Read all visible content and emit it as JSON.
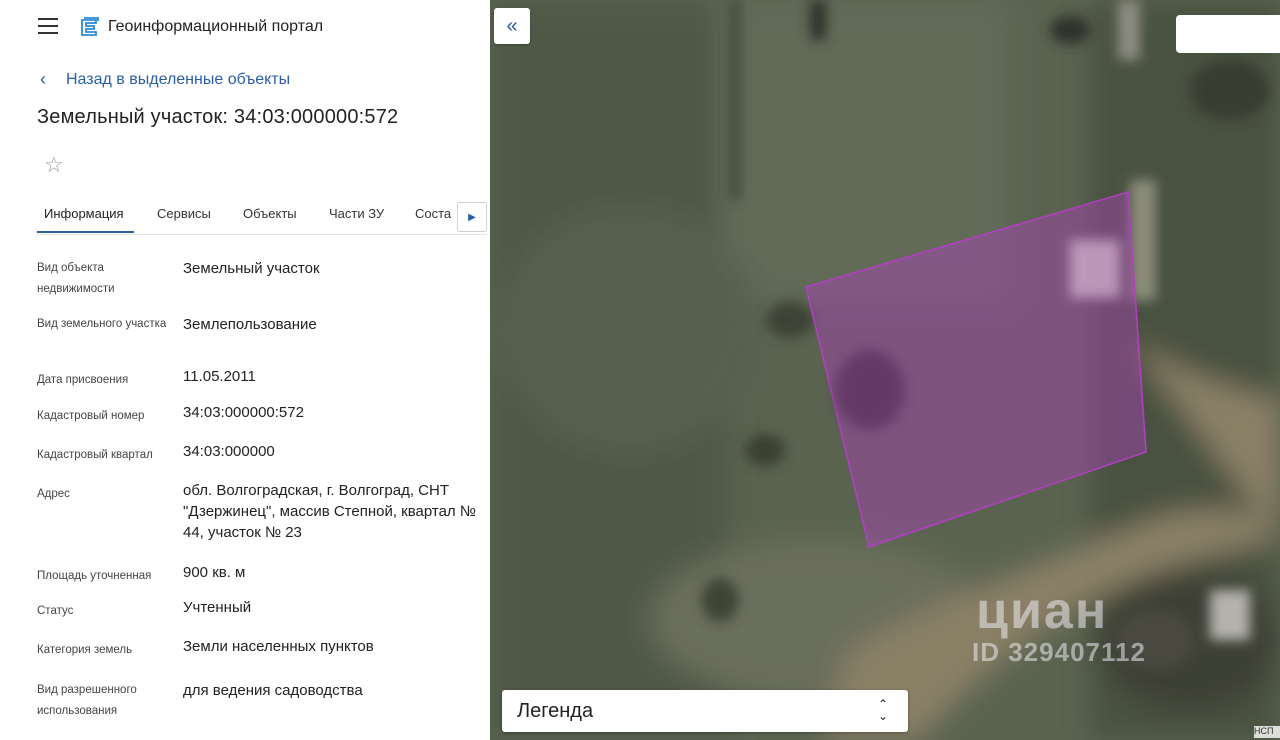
{
  "header": {
    "app_title": "Геоинформационный портал"
  },
  "navigation": {
    "back_label": "Назад в выделенные объекты"
  },
  "object": {
    "title": "Земельный участок: 34:03:000000:572"
  },
  "tabs": [
    {
      "label": "Информация",
      "active": true
    },
    {
      "label": "Сервисы",
      "active": false
    },
    {
      "label": "Объекты",
      "active": false
    },
    {
      "label": "Части ЗУ",
      "active": false
    },
    {
      "label": "Соста",
      "active": false
    }
  ],
  "info": [
    {
      "label": "Вид объекта недвижимости",
      "value": "Земельный участок"
    },
    {
      "label": "Вид земельного участка",
      "value": "Землепользование"
    },
    {
      "label": "Дата присвоения",
      "value": "11.05.2011"
    },
    {
      "label": "Кадастровый номер",
      "value": "34:03:000000:572"
    },
    {
      "label": "Кадастровый квартал",
      "value": "34:03:000000"
    },
    {
      "label": "Адрес",
      "value": "обл. Волгоградская, г. Волгоград, СНТ \"Дзержинец\", массив Степной, квартал № 44, участок № 23"
    },
    {
      "label": "Площадь уточненная",
      "value": "900 кв. м"
    },
    {
      "label": "Статус",
      "value": "Учтенный"
    },
    {
      "label": "Категория земель",
      "value": "Земли населенных пунктов"
    },
    {
      "label": "Вид разрешенного использования",
      "value": "для ведения садоводства"
    }
  ],
  "map": {
    "legend_label": "Легенда",
    "watermark_brand": "циан",
    "watermark_id": "ID 329407112",
    "attribution": "НСП",
    "parcel_color": "#b040c0"
  },
  "colors": {
    "accent": "#2a5ea8"
  }
}
